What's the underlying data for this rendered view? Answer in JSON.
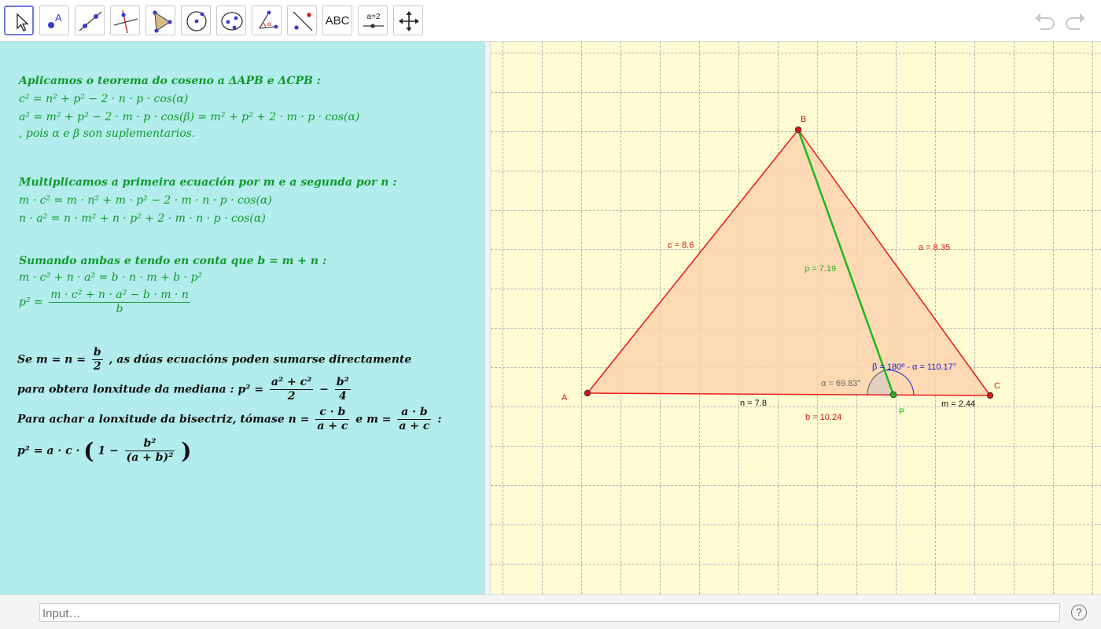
{
  "toolbar": {
    "tools": [
      {
        "name": "move-tool",
        "icon": "cursor-arrow-icon"
      },
      {
        "name": "point-tool",
        "icon": "point-icon"
      },
      {
        "name": "line-tool",
        "icon": "line-icon"
      },
      {
        "name": "perpendicular-tool",
        "icon": "perpendicular-line-icon"
      },
      {
        "name": "polygon-tool",
        "icon": "polygon-icon"
      },
      {
        "name": "circle-tool",
        "icon": "circle-center-icon"
      },
      {
        "name": "ellipse-tool",
        "icon": "ellipse-icon"
      },
      {
        "name": "angle-tool",
        "icon": "angle-icon"
      },
      {
        "name": "reflect-tool",
        "icon": "reflect-icon"
      },
      {
        "name": "text-tool",
        "icon": "text-icon",
        "label": "ABC"
      },
      {
        "name": "slider-tool",
        "icon": "slider-icon",
        "label": "a=2"
      },
      {
        "name": "move-view-tool",
        "icon": "move-arrows-icon"
      }
    ],
    "undo_icon": "undo-icon",
    "redo_icon": "redo-icon"
  },
  "text_panel": {
    "s1_head": "Aplicamos o teorema do coseno a ΔAPB e ΔCPB :",
    "s1_eq1": "c² = n² + p² − 2 · n · p · cos(α)",
    "s1_eq2": "a² = m² + p² − 2 · m · p · cos(β) = m² + p² + 2 · m · p · cos(α)",
    "s1_tail": ", pois α e β son suplementarios.",
    "s2_head": "Multiplicamos a primeira ecuación por m e a segunda por n :",
    "s2_eq1": "m · c² = m · n² + m · p² − 2 · m · n · p · cos(α)",
    "s2_eq2": "n · a² = n · m² + n · p² + 2 · m · n · p · cos(α)",
    "s3_head": "Sumando ambas e tendo en conta que b = m + n :",
    "s3_eq1": "m · c² + n · a² = b · n · m + b · p²",
    "s3_eq2_lhs": "p² =",
    "s3_eq2_num": "m · c² + n · a² − b · m · n",
    "s3_eq2_den": "b",
    "s4_a": "Se m = n =",
    "s4_frac_num": "b",
    "s4_frac_den": "2",
    "s4_b": ", as dúas ecuacións poden sumarse directamente",
    "s5_a": "para obtera lonxitude da mediana :  p² =",
    "s5_f1_num": "a² + c²",
    "s5_f1_den": "2",
    "s5_minus": "−",
    "s5_f2_num": "b²",
    "s5_f2_den": "4",
    "s6_a": "Para achar a lonxitude da bisectriz, tómase n =",
    "s6_f1_num": "c · b",
    "s6_f1_den": "a + c",
    "s6_b": "e m =",
    "s6_f2_num": "a · b",
    "s6_f2_den": "a + c",
    "s6_c": ":",
    "s7_a": "p² = a · c ·",
    "s7_lparen": "(",
    "s7_b": "1 −",
    "s7_f_num": "b²",
    "s7_f_den": "(a + b)²",
    "s7_rparen": ")"
  },
  "graphics": {
    "labels": {
      "A": "A",
      "B": "B",
      "C": "C",
      "P": "P",
      "c": "c = 8.6",
      "a": "a = 8.35",
      "p": "p = 7.19",
      "n": "n = 7.8",
      "m": "m = 2.44",
      "b": "b = 10.24",
      "alpha": "α = 69.83°",
      "beta": "β = 180º - α = 110.17°"
    },
    "colors": {
      "background": "#fffbd3",
      "triangle_fill": "#fdd3ad",
      "triangle_edge": "#e81a1a",
      "segment_p": "#1ab81a",
      "point_red": "#d01818",
      "point_green": "#22b522",
      "beta_label": "#1a1ad8",
      "alpha_label": "#666666"
    }
  },
  "input_bar": {
    "placeholder": "Input…",
    "help_label": "?"
  }
}
